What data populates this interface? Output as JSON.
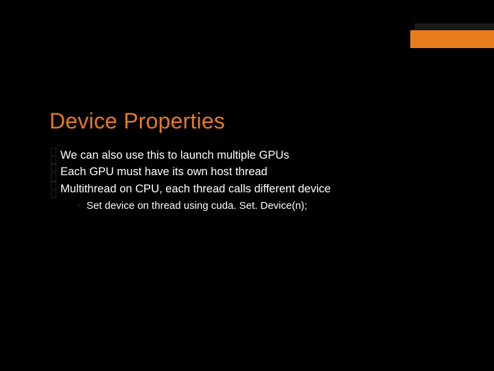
{
  "accent_color": "#E87B1C",
  "title": "Device Properties",
  "bullets": [
    {
      "text": "We can also use this to launch multiple GPUs"
    },
    {
      "text": "Each GPU must have its own host thread"
    },
    {
      "text": "Multithread on CPU, each thread calls different device",
      "sub": [
        {
          "text": "Set device on thread using cuda. Set. Device(n);"
        }
      ]
    }
  ]
}
